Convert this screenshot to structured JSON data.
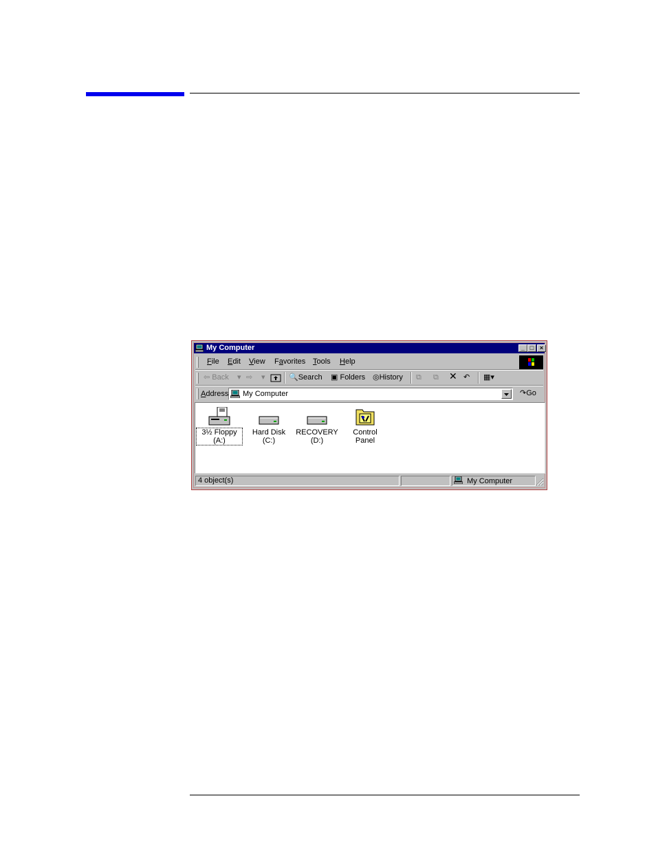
{
  "window": {
    "title": "My Computer",
    "menu": [
      {
        "label_pre": "",
        "accel": "F",
        "label_post": "ile"
      },
      {
        "label_pre": "",
        "accel": "E",
        "label_post": "dit"
      },
      {
        "label_pre": "",
        "accel": "V",
        "label_post": "iew"
      },
      {
        "label_pre": "F",
        "accel": "a",
        "label_post": "vorites"
      },
      {
        "label_pre": "",
        "accel": "T",
        "label_post": "ools"
      },
      {
        "label_pre": "",
        "accel": "H",
        "label_post": "elp"
      }
    ],
    "toolbar": {
      "back": "Back",
      "search": "Search",
      "folders": "Folders",
      "history": "History"
    },
    "address": {
      "label": "Address",
      "value": "My Computer",
      "go": "Go"
    },
    "items": [
      {
        "label": "3½ Floppy (A:)",
        "icon": "floppy-drive-icon"
      },
      {
        "label": "Hard Disk (C:)",
        "icon": "hard-disk-icon"
      },
      {
        "label": "RECOVERY\n(D:)",
        "icon": "hard-disk-icon"
      },
      {
        "label": "Control Panel",
        "icon": "control-panel-folder-icon"
      }
    ],
    "status": {
      "objects": "4 object(s)",
      "zone": "My Computer"
    }
  }
}
